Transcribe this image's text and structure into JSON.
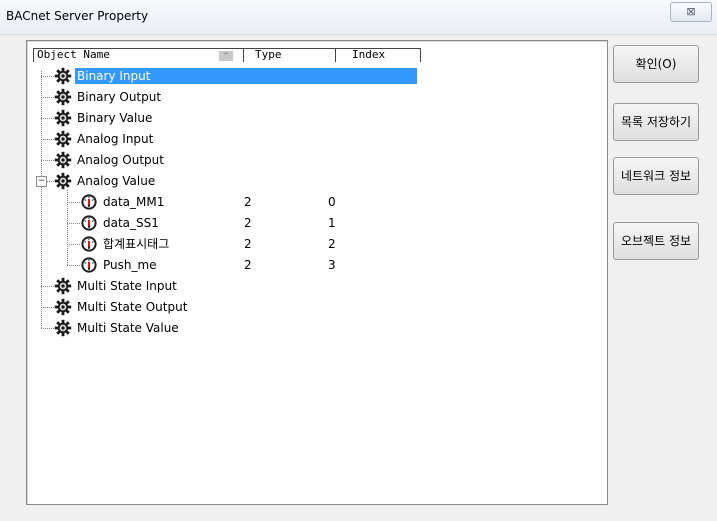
{
  "window": {
    "title": "BACnet Server Property",
    "close_label": "⊠"
  },
  "table": {
    "columns": [
      "Object Name",
      "Type",
      "Index"
    ],
    "sort_indicator": "^",
    "rows": [
      {
        "name": "Binary Input",
        "type": "",
        "index": "",
        "icon": "gear-icon",
        "selected": true
      },
      {
        "name": "Binary Output",
        "type": "",
        "index": "",
        "icon": "gear-icon"
      },
      {
        "name": "Binary Value",
        "type": "",
        "index": "",
        "icon": "gear-icon"
      },
      {
        "name": "Analog Input",
        "type": "",
        "index": "",
        "icon": "gear-icon"
      },
      {
        "name": "Analog Output",
        "type": "",
        "index": "",
        "icon": "gear-icon"
      },
      {
        "name": "Analog Value",
        "type": "",
        "index": "",
        "icon": "gear-icon",
        "expanded": true
      },
      {
        "name": "data_MM1",
        "type": "2",
        "index": "0",
        "icon": "gauge-icon"
      },
      {
        "name": "data_SS1",
        "type": "2",
        "index": "1",
        "icon": "gauge-icon"
      },
      {
        "name": "합계표시태그",
        "type": "2",
        "index": "2",
        "icon": "gauge-icon"
      },
      {
        "name": "Push_me",
        "type": "2",
        "index": "3",
        "icon": "gauge-icon"
      },
      {
        "name": "Multi State Input",
        "type": "",
        "index": "",
        "icon": "gear-icon"
      },
      {
        "name": "Multi State Output",
        "type": "",
        "index": "",
        "icon": "gear-icon"
      },
      {
        "name": "Multi State Value",
        "type": "",
        "index": "",
        "icon": "gear-icon"
      }
    ]
  },
  "buttons": {
    "ok": "확인(O)",
    "save_list": "목록 저장하기",
    "network_info": "네트워크 정보",
    "object_info": "오브젝트 정보"
  },
  "colors": {
    "selection": "#3399ff",
    "gear": "#1a1a1a",
    "gauge_needle": "#cc0000"
  }
}
